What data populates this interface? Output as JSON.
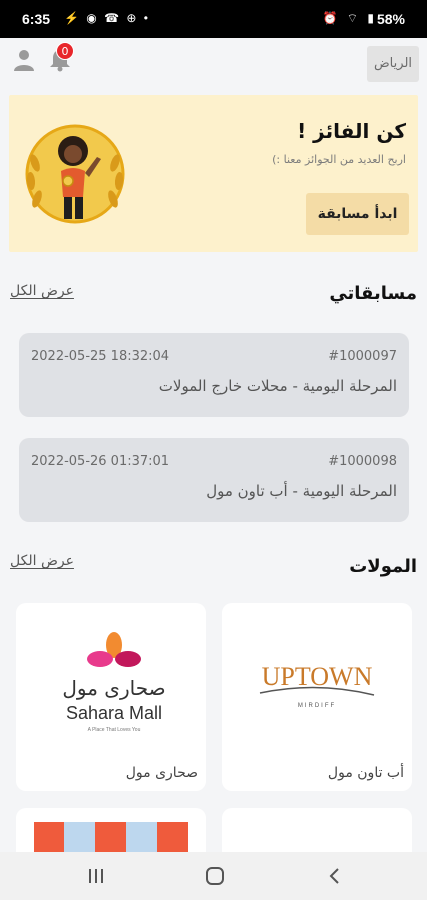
{
  "status_bar": {
    "time": "6:35",
    "left_icons": "⚡ ◉ ☎ ⊕ •",
    "right_icons": "⏰ ⌔ ▮",
    "battery": "58%"
  },
  "header": {
    "city": "الرياض",
    "notification_count": "0"
  },
  "banner": {
    "title": "كن الفائز !",
    "subtitle": "اربح العديد من الجوائز معنا :)",
    "button": "ابدأ مسابقة"
  },
  "competitions": {
    "title": "مسابقاتي",
    "view_all": "عرض الكل",
    "items": [
      {
        "id": "#1000097",
        "date": "2022-05-25 18:32:04",
        "name": "المرحلة اليومية - محلات خارج المولات"
      },
      {
        "id": "#1000098",
        "date": "2022-05-26 01:37:01",
        "name": "المرحلة اليومية - أب تاون مول"
      }
    ]
  },
  "malls": {
    "title": "المولات",
    "view_all": "عرض الكل",
    "items": [
      {
        "name": "أب تاون مول",
        "logo_text": "UPTOWN",
        "logo_sub": "MIRDIFF"
      },
      {
        "name": "صحارى مول",
        "logo_arabic": "صحارى مول",
        "logo_text": "Sahara Mall",
        "logo_tagline": "A Place That Loves You"
      }
    ]
  },
  "colors": {
    "banner_bg": "#fdf1cc",
    "button_bg": "#f4dca6",
    "badge": "#e8262b",
    "card_bg": "#dfe1e5"
  }
}
